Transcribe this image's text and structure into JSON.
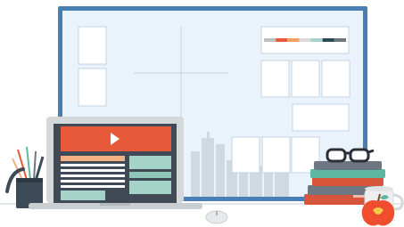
{
  "scene": {
    "colors": {
      "board_frame": "#4a7fb5",
      "board_fill": "#eaf3fb",
      "board_card": "#ffffff",
      "board_line": "#c3d4e4",
      "skyline": "#cfd9e2",
      "laptop_body": "#d4d8db",
      "laptop_screen": "#3f4a56",
      "laptop_video": "#e8593a",
      "laptop_text_bar": "#f4b183",
      "laptop_panel": "#a6d3c7",
      "laptop_panel_alt": "#8fc6b8",
      "book_red": "#d7553a",
      "book_teal": "#5cb8a1",
      "book_grey": "#6e7781",
      "glasses": "#2b3036",
      "cup": "#eeeeee",
      "apple": "#f04c2e",
      "pencil_cup": "#3d4a57"
    },
    "color_strip": [
      "#bfbfbf",
      "#e8593a",
      "#f4a261",
      "#d9d9d9",
      "#a6d3c7",
      "#2a4858",
      "#6e7781"
    ],
    "icons": {
      "play": "play-icon",
      "glasses": "glasses-icon",
      "apple": "apple-icon",
      "mouse": "mouse-icon",
      "coffee_cup": "coffee-cup-icon",
      "pencil_cup": "pencil-cup-icon",
      "books": "books-icon"
    }
  }
}
